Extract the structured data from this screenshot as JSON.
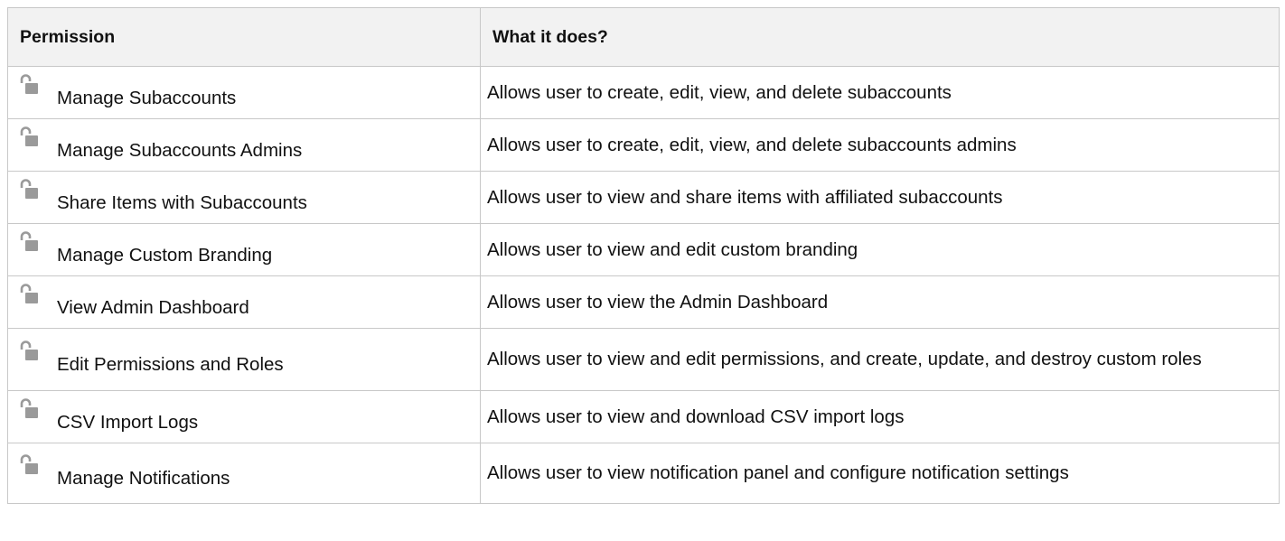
{
  "table": {
    "headers": {
      "permission": "Permission",
      "description": "What it does?"
    },
    "rows": [
      {
        "name": "Manage Subaccounts",
        "description": "Allows user to create, edit, view, and delete subaccounts",
        "icon": "unlocked-padlock-icon"
      },
      {
        "name": "Manage Subaccounts Admins",
        "description": "Allows user to create, edit, view, and delete subaccounts admins",
        "icon": "unlocked-padlock-icon"
      },
      {
        "name": "Share Items with Subaccounts",
        "description": "Allows user to view and share items with affiliated subaccounts",
        "icon": "unlocked-padlock-icon"
      },
      {
        "name": "Manage Custom Branding",
        "description": "Allows user to view and edit custom branding",
        "icon": "unlocked-padlock-icon"
      },
      {
        "name": "View Admin Dashboard",
        "description": "Allows user to view the Admin Dashboard",
        "icon": "unlocked-padlock-icon"
      },
      {
        "name": "Edit Permissions and Roles",
        "description": "Allows user to view and edit permissions, and create, update, and destroy custom roles",
        "icon": "unlocked-padlock-icon"
      },
      {
        "name": "CSV Import Logs",
        "description": "Allows user to view and download CSV import logs",
        "icon": "unlocked-padlock-icon"
      },
      {
        "name": "Manage Notifications",
        "description": "Allows user to view notification panel and configure notification settings",
        "icon": "unlocked-padlock-icon"
      }
    ]
  },
  "colors": {
    "header_bg": "#f2f2f2",
    "border": "#c8c8c8",
    "icon": "#9a9a9a",
    "text": "#111111"
  }
}
